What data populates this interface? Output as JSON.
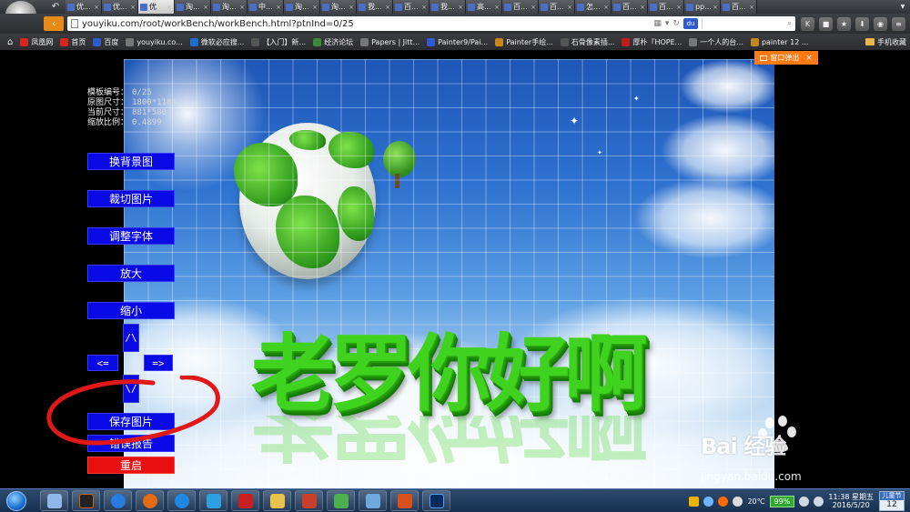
{
  "browser": {
    "tabs": [
      {
        "label": "优..."
      },
      {
        "label": "优..."
      },
      {
        "label": "优"
      },
      {
        "label": "淘..."
      },
      {
        "label": "淘..."
      },
      {
        "label": "中..."
      },
      {
        "label": "淘..."
      },
      {
        "label": "淘..."
      },
      {
        "label": "我..."
      },
      {
        "label": "百..."
      },
      {
        "label": "我..."
      },
      {
        "label": "高..."
      },
      {
        "label": "百..."
      },
      {
        "label": "百..."
      },
      {
        "label": "怎..."
      },
      {
        "label": "百..."
      },
      {
        "label": "百..."
      },
      {
        "label": "pp..."
      },
      {
        "label": "百..."
      }
    ],
    "active_tab_index": 2,
    "address_url": "youyiku.com/root/workBench/workBench.html?ptnInd=0/25",
    "bookmarks": [
      {
        "label": "凤凰网",
        "color": "#d9261c"
      },
      {
        "label": "首页",
        "color": "#d9261c"
      },
      {
        "label": "百度",
        "color": "#2e5bd1"
      },
      {
        "label": "youyiku.co...",
        "color": "#777777"
      },
      {
        "label": "微软必应搜...",
        "color": "#1a6fd1"
      },
      {
        "label": "【入门】新...",
        "color": "#555555"
      },
      {
        "label": "经济论坛",
        "color": "#3a8a3a"
      },
      {
        "label": "Papers | Jitt...",
        "color": "#777777"
      },
      {
        "label": "Painter9/Pai...",
        "color": "#2e5bd1"
      },
      {
        "label": "Painter手绘...",
        "color": "#c4891a"
      },
      {
        "label": "石骨像素插...",
        "color": "#555555"
      },
      {
        "label": "厚朴『HOPE...",
        "color": "#c21d1d"
      },
      {
        "label": "一个人的台...",
        "color": "#777777"
      },
      {
        "label": "painter 12 ...",
        "color": "#c4891a"
      }
    ],
    "bookmarks_right": "手机收藏",
    "popup_button": "窗口弹出"
  },
  "info": {
    "template_label": "模板编号：",
    "template_value": "0/25",
    "original_label": "原图尺寸：",
    "original_value": "1800*1184",
    "current_label": "当前尺寸：",
    "current_value": "881*580",
    "scale_label": "缩放比例：",
    "scale_value": "0.4899"
  },
  "controls": {
    "change_bg": "换背景图",
    "crop": "裁切图片",
    "adjust_font": "调整字体",
    "zoom_in": "放大",
    "zoom_out": "缩小",
    "up": "/\\",
    "left": "<=",
    "right": "=>",
    "down": "\\/",
    "save": "保存图片",
    "report": "错误报告",
    "restart": "重启"
  },
  "canvas": {
    "headline": "老罗你好啊"
  },
  "watermark": {
    "brand": "Bai 经验",
    "url": "jingyan.baidu.com"
  },
  "taskbar": {
    "temperature": "20℃",
    "battery": "99%",
    "time": "11:38 星期五",
    "date": "2016/5/20",
    "calendar_top": "儿童节",
    "calendar_day": "12"
  },
  "colors": {
    "control_blue": "#0a0ae6",
    "control_red": "#e81010",
    "headline_green": "#3fd320",
    "popup_orange": "#ff7a12",
    "annotation_red": "#e01818"
  }
}
